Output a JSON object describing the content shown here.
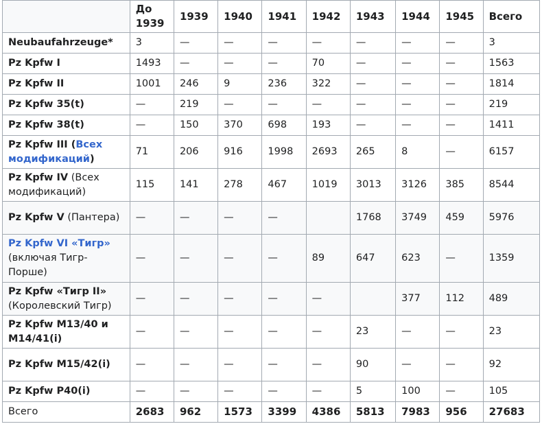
{
  "header": {
    "first": "",
    "years": [
      "До 1939",
      "1939",
      "1940",
      "1941",
      "1942",
      "1943",
      "1944",
      "1945",
      "Всего"
    ]
  },
  "rows": [
    {
      "name": "Neubaufahrzeuge*",
      "values": [
        "3",
        "—",
        "—",
        "—",
        "—",
        "—",
        "—",
        "—",
        "3"
      ]
    },
    {
      "name": "Pz Kpfw I",
      "values": [
        "1493",
        "—",
        "—",
        "—",
        "70",
        "—",
        "—",
        "—",
        "1563"
      ]
    },
    {
      "name": "Pz Kpfw II",
      "values": [
        "1001",
        "246",
        "9",
        "236",
        "322",
        "—",
        "—",
        "—",
        "1814"
      ]
    },
    {
      "name": "Pz Kpfw 35(t)",
      "values": [
        "—",
        "219",
        "—",
        "—",
        "—",
        "—",
        "—",
        "—",
        "219"
      ]
    },
    {
      "name": "Pz Kpfw 38(t)",
      "values": [
        "—",
        "150",
        "370",
        "698",
        "193",
        "—",
        "—",
        "—",
        "1411"
      ]
    },
    {
      "name": "Pz Kpfw III (",
      "link": "Всех модификаций",
      "name_end": ")",
      "values": [
        "71",
        "206",
        "916",
        "1998",
        "2693",
        "265",
        "8",
        "—",
        "6157"
      ]
    },
    {
      "name": "Pz Kpfw IV",
      "sub": " (Всех модификаций)",
      "values": [
        "115",
        "141",
        "278",
        "467",
        "1019",
        "3013",
        "3126",
        "385",
        "8544"
      ]
    },
    {
      "name": "Pz Kpfw V",
      "sub": " (Пантера)",
      "values": [
        "—",
        "—",
        "—",
        "—",
        "",
        "1768",
        "3749",
        "459",
        "5976"
      ]
    },
    {
      "link_name": "Pz Kpfw VI «Тигр»",
      "sub": " (включая Тигр-Порше)",
      "values": [
        "—",
        "—",
        "—",
        "—",
        "89",
        "647",
        "623",
        "—",
        "1359"
      ]
    },
    {
      "name": "Pz Kpfw «Тигр II»",
      "sub": " (Королевский Тигр)",
      "values": [
        "—",
        "—",
        "—",
        "—",
        "—",
        "",
        "377",
        "112",
        "489"
      ]
    },
    {
      "name": "Pz Kpfw M13/40 и M14/41(i)",
      "values": [
        "—",
        "—",
        "—",
        "—",
        "—",
        "23",
        "—",
        "—",
        "23"
      ]
    },
    {
      "name": "Pz Kpfw M15/42(i)",
      "values": [
        "—",
        "—",
        "—",
        "—",
        "—",
        "90",
        "—",
        "—",
        "92"
      ]
    },
    {
      "name": "Pz Kpfw P40(i)",
      "values": [
        "—",
        "—",
        "—",
        "—",
        "—",
        "5",
        "100",
        "—",
        "105"
      ]
    }
  ],
  "total": {
    "name": "Всего",
    "values": [
      "2683",
      "962",
      "1573",
      "3399",
      "4386",
      "5813",
      "7983",
      "956",
      "27683"
    ]
  }
}
